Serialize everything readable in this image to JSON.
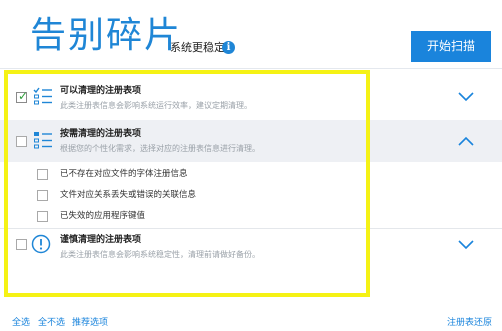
{
  "header": {
    "title": "告别碎片",
    "subtitle": "系统更稳定",
    "info_icon": "i",
    "start_button": "开始扫描"
  },
  "categories": [
    {
      "title": "可以清理的注册表项",
      "description": "此类注册表信息会影响系统运行效率，建议定期清理。",
      "checked": true,
      "icon": "checklist-icon",
      "expanded": false
    },
    {
      "title": "按需清理的注册表项",
      "description": "根据您的个性化需求，选择对应的注册表信息进行清理。",
      "checked": false,
      "icon": "list-icon",
      "expanded": true,
      "items": [
        {
          "label": "已不存在对应文件的字体注册信息",
          "checked": false
        },
        {
          "label": "文件对应关系丢失或错误的关联信息",
          "checked": false
        },
        {
          "label": "已失效的应用程序键值",
          "checked": false
        }
      ]
    },
    {
      "title": "谨慎清理的注册表项",
      "description": "此类注册表信息会影响系统稳定性，清理前请做好备份。",
      "checked": false,
      "icon": "warning-icon",
      "expanded": false
    }
  ],
  "footer": {
    "select_all": "全选",
    "select_none": "全不选",
    "recommended": "推荐选项",
    "restore": "注册表还原"
  },
  "colors": {
    "accent": "#1a84dc",
    "highlight": "#f5f215",
    "selected_row": "#eef0f4"
  }
}
